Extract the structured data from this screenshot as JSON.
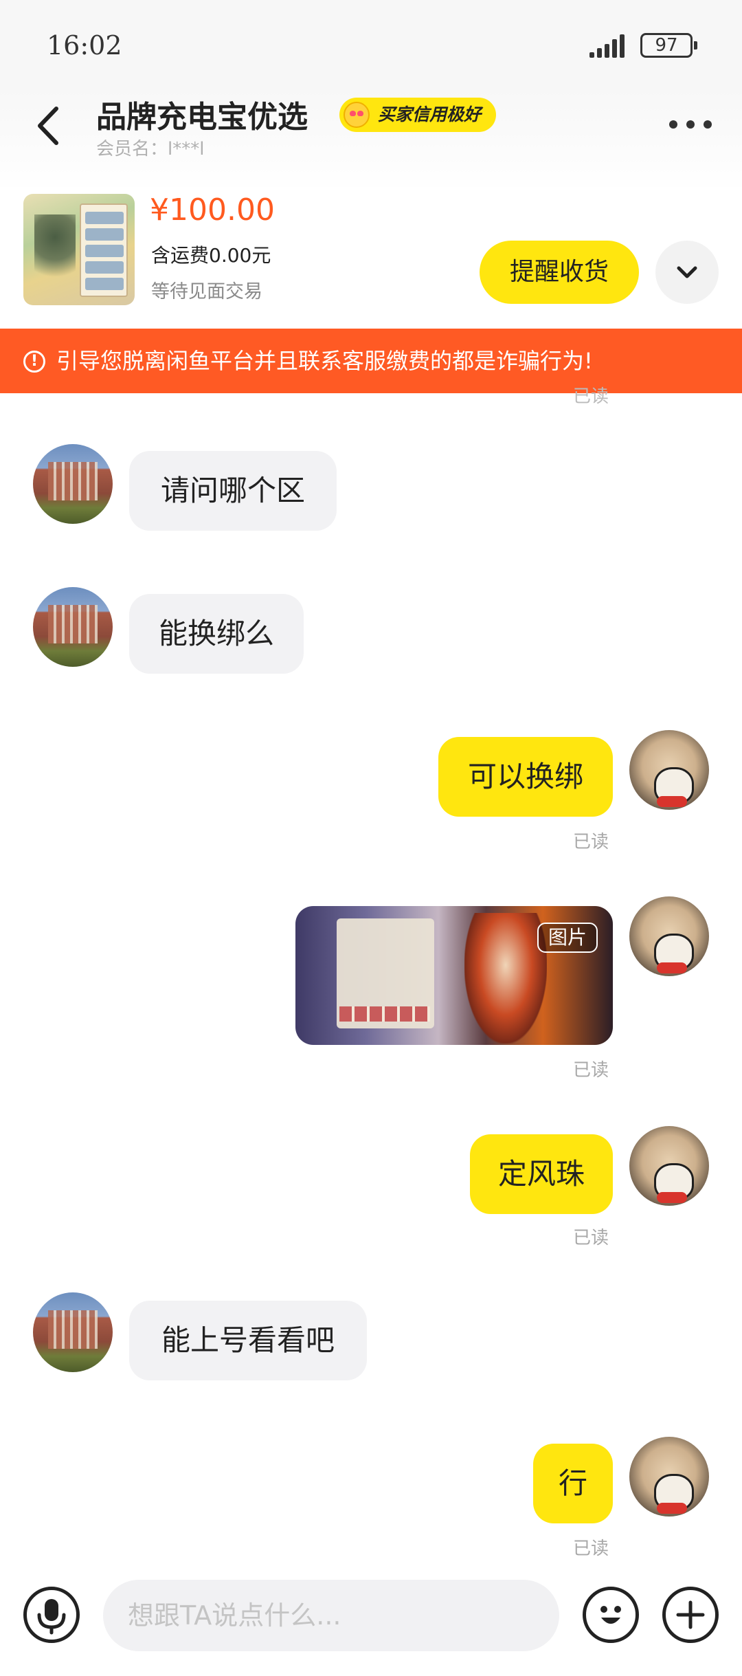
{
  "status_bar": {
    "time": "16:02",
    "battery": "97"
  },
  "header": {
    "shop_name": "品牌充电宝优选",
    "credit_badge": "买家信用极好",
    "member_label": "会员名：l***l"
  },
  "product": {
    "price": "¥100.00",
    "shipping": "含运费0.00元",
    "status": "等待见面交易",
    "remind_button": "提醒收货"
  },
  "warning_banner": {
    "text": "引导您脱离闲鱼平台并且联系客服缴费的都是诈骗行为!",
    "icon": "alert-circle-icon"
  },
  "peek_read": "已读",
  "messages": [
    {
      "side": "in",
      "text": "请问哪个区"
    },
    {
      "side": "in",
      "text": "能换绑么"
    },
    {
      "side": "out",
      "text": "可以换绑",
      "read": "已读"
    },
    {
      "side": "out",
      "type": "image",
      "tag": "图片",
      "read": "已读"
    },
    {
      "side": "out",
      "text": "定风珠",
      "read": "已读"
    },
    {
      "side": "in",
      "text": "能上号看看吧"
    },
    {
      "side": "out",
      "text": "行",
      "read": "已读"
    }
  ],
  "input": {
    "placeholder": "想跟TA说点什么..."
  },
  "colors": {
    "accent_yellow": "#ffe60f",
    "warning_orange": "#ff5a24",
    "price_orange": "#ff5a1f"
  }
}
